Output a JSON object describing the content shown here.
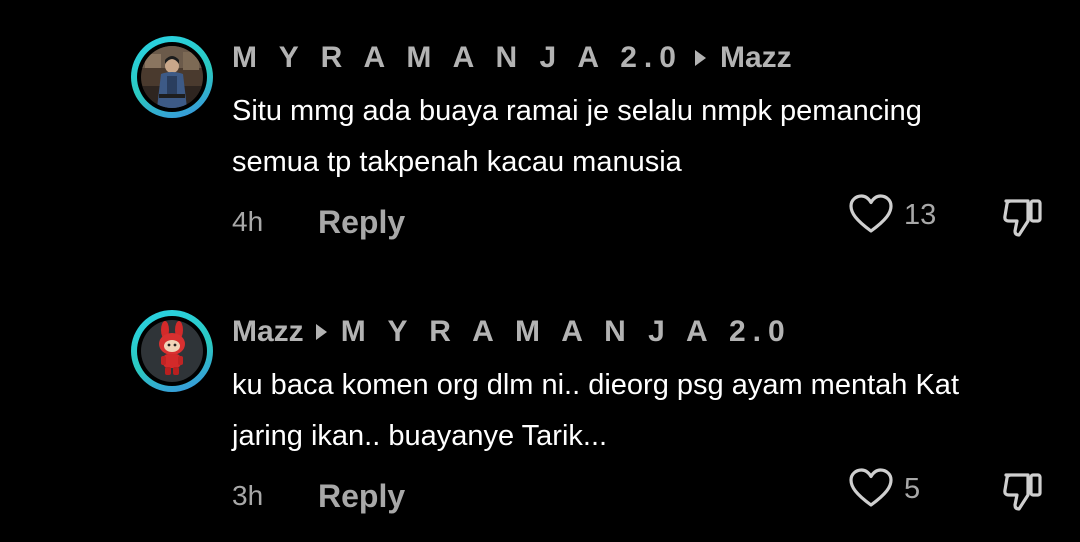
{
  "colors": {
    "background": "#000000",
    "text_primary": "#ffffff",
    "text_secondary": "#a8a8a8",
    "username": "#b3b3b3",
    "avatar_ring": "#2bc9c0"
  },
  "comments": [
    {
      "author": "M Y R A M A N J A 2.0",
      "reply_to": "Mazz",
      "text_lines": [
        "Situ mmg ada buaya ramai je selalu nmpk pemancing",
        "semua tp takpenah kacau manusia"
      ],
      "time": "4h",
      "reply_label": "Reply",
      "likes": "13",
      "avatar_icon": "user-photo-avatar",
      "like_icon": "heart-outline-icon",
      "dislike_icon": "thumbs-down-icon"
    },
    {
      "author": "Mazz",
      "reply_to": "M Y R A M A N J A 2.0",
      "text_lines": [
        "ku baca komen org dlm ni.. dieorg psg ayam mentah Kat",
        "jaring ikan.. buayanye Tarik..."
      ],
      "time": "3h",
      "reply_label": "Reply",
      "likes": "5",
      "avatar_icon": "red-bunny-toy-avatar",
      "like_icon": "heart-outline-icon",
      "dislike_icon": "thumbs-down-icon"
    }
  ]
}
